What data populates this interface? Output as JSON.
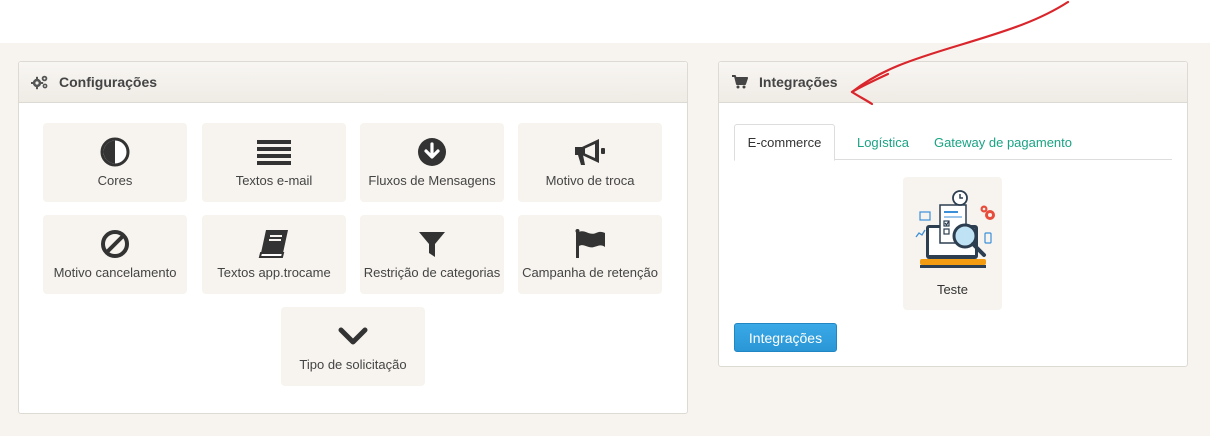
{
  "config_panel": {
    "title": "Configurações",
    "tiles": [
      {
        "label": "Cores",
        "icon": "half-circle-icon"
      },
      {
        "label": "Textos e-mail",
        "icon": "lines-icon"
      },
      {
        "label": "Fluxos de Mensagens",
        "icon": "arrow-down-circle-icon"
      },
      {
        "label": "Motivo de troca",
        "icon": "megaphone-icon"
      },
      {
        "label": "Motivo cancelamento",
        "icon": "ban-icon"
      },
      {
        "label": "Textos app.trocame",
        "icon": "book-icon"
      },
      {
        "label": "Restrição de categorias",
        "icon": "filter-icon"
      },
      {
        "label": "Campanha de retenção",
        "icon": "flag-icon"
      },
      {
        "label": "Tipo de solicitação",
        "icon": "chevron-down-icon"
      }
    ]
  },
  "integ_panel": {
    "title": "Integrações",
    "tabs": [
      {
        "label": "E-commerce",
        "active": true
      },
      {
        "label": "Logística",
        "active": false
      },
      {
        "label": "Gateway de pagamento",
        "active": false
      }
    ],
    "card_label": "Teste",
    "button_label": "Integrações"
  },
  "colors": {
    "accent": "#1aa384",
    "primary_button": "#2a96d6",
    "page_background": "#f7f4ef",
    "annotation": "#d9262c"
  }
}
